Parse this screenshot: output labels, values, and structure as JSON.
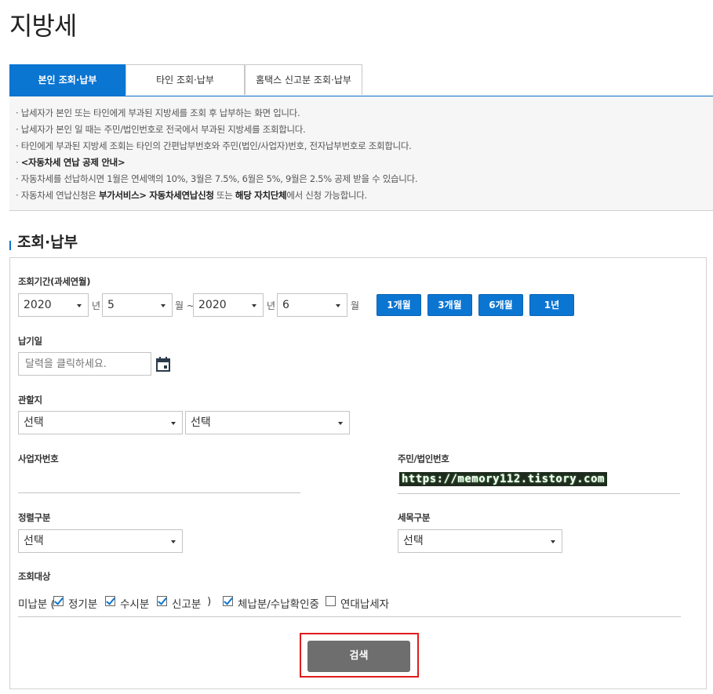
{
  "page": {
    "title": "지방세"
  },
  "tabs": [
    {
      "label": "본인 조회·납부",
      "active": true
    },
    {
      "label": "타인 조회·납부",
      "active": false
    },
    {
      "label": "홈택스 신고분 조회·납부",
      "active": false
    }
  ],
  "notice": {
    "lines": [
      {
        "text": "· 납세자가 본인 또는 타인에게 부과된 지방세를 조회 후 납부하는 화면 입니다."
      },
      {
        "text": "· 납세자가 본인 일 때는 주민/법인번호로 전국에서 부과된 지방세를 조회합니다."
      },
      {
        "text": "· 타인에게 부과된 지방세 조회는 타인의 간편납부번호와 주민(법인/사업자)번호, 전자납부번호로 조회합니다."
      },
      {
        "bold": "<자동차세 연납 공제 안내>"
      },
      {
        "text": "· 자동차세를 선납하시면 1월은 연세액의 10%, 3월은 7.5%, 6월은 5%, 9월은 2.5% 공제 받을 수 있습니다."
      },
      {
        "p1": "· 자동차세 연납신청은 ",
        "b1": "부가서비스> 자동차세연납신청",
        "p2": " 또는 ",
        "b2": "해당 자치단체",
        "p3": "에서 신청 가능합니다."
      }
    ]
  },
  "section": {
    "title": "조회·납부"
  },
  "period": {
    "label": "조회기간(과세연월)",
    "from_year": "2020",
    "year_unit": "년",
    "from_month": "5",
    "month_unit_tilde": "월 ~",
    "to_year": "2020",
    "to_month": "6",
    "month_unit": "월",
    "quick_buttons": [
      "1개월",
      "3개월",
      "6개월",
      "1년"
    ]
  },
  "due_date": {
    "label": "납기일",
    "placeholder": "달력을 클릭하세요."
  },
  "jurisdiction": {
    "label": "관할지",
    "select1": "선택",
    "select2": "선택"
  },
  "business_no": {
    "label": "사업자번호"
  },
  "resident_no": {
    "label": "주민/법인번호"
  },
  "watermark": "https://memory112.tistory.com",
  "levy_type": {
    "label": "정렬구분",
    "value": "선택"
  },
  "tax_item": {
    "label": "세목구분",
    "value": "선택"
  },
  "target": {
    "label": "조회대상",
    "prefix": "미납분 (",
    "suffix": ")",
    "options": [
      {
        "label": "정기분",
        "checked": true
      },
      {
        "label": "수시분",
        "checked": true
      },
      {
        "label": "신고분",
        "checked": true
      },
      {
        "label": "체납분/수납확인중",
        "checked": true
      },
      {
        "label": "연대납세자",
        "checked": false
      }
    ]
  },
  "search_button": "검색",
  "colors": {
    "accent": "#0b75d2",
    "highlight": "#e11b1b",
    "search_button": "#6e6e6e"
  }
}
